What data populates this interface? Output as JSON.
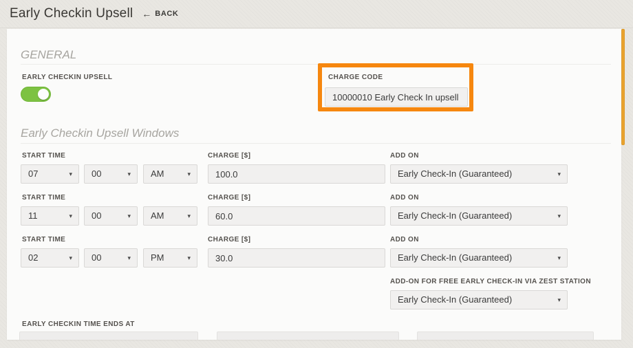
{
  "header": {
    "title": "Early Checkin Upsell",
    "back_arrow": "←",
    "back_label": "BACK"
  },
  "icons": {
    "caret": "▾"
  },
  "general": {
    "heading": "GENERAL",
    "toggle": {
      "label": "EARLY CHECKIN UPSELL",
      "state": "on"
    },
    "charge_code": {
      "label": "CHARGE CODE",
      "value": "10000010 Early Check In upsell",
      "highlighted": true
    }
  },
  "windows": {
    "heading": "Early Checkin Upsell Windows",
    "labels": {
      "start_time": "START TIME",
      "charge": "CHARGE [$]",
      "add_on": "ADD ON"
    },
    "rows": [
      {
        "hour": "07",
        "minute": "00",
        "meridiem": "AM",
        "charge": "100.0",
        "add_on": "Early Check-In (Guaranteed)"
      },
      {
        "hour": "11",
        "minute": "00",
        "meridiem": "AM",
        "charge": "60.0",
        "add_on": "Early Check-In (Guaranteed)"
      },
      {
        "hour": "02",
        "minute": "00",
        "meridiem": "PM",
        "charge": "30.0",
        "add_on": "Early Check-In (Guaranteed)"
      }
    ],
    "zest": {
      "label": "ADD-ON FOR FREE EARLY CHECK-IN VIA ZEST STATION",
      "value": "Early Check-In (Guaranteed)"
    },
    "ends_at_label": "EARLY CHECKIN TIME ENDS AT"
  },
  "colors": {
    "annotation_orange": "#f6870f",
    "scrollbar_orange": "#e9a32e",
    "toggle_green": "#7dc242"
  }
}
